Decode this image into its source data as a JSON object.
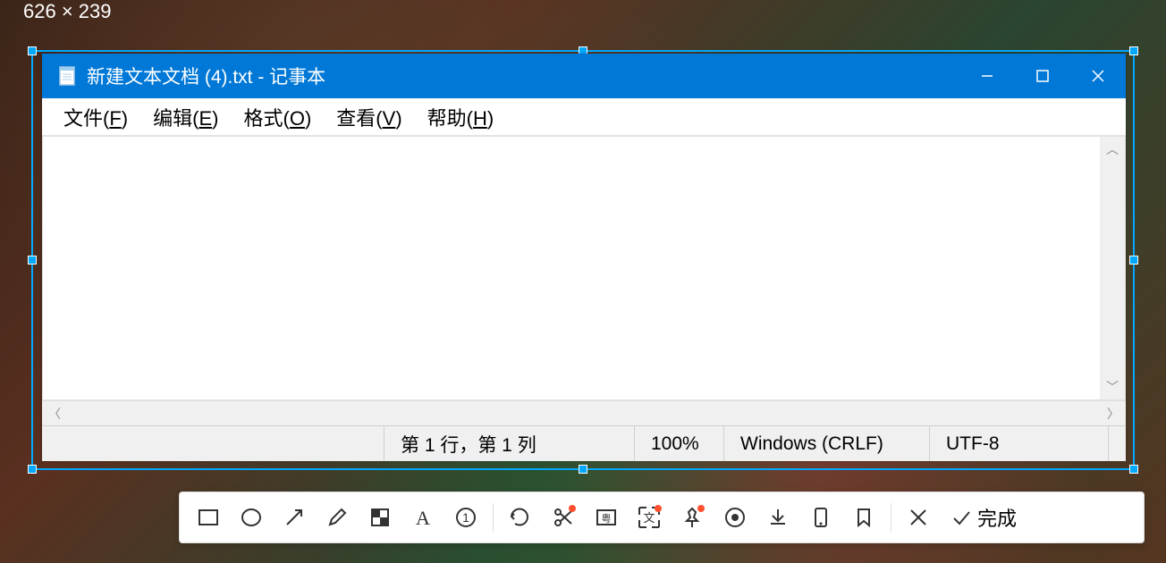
{
  "selection": {
    "size_label": "626 × 239"
  },
  "notepad": {
    "title": "新建文本文档 (4).txt - 记事本",
    "menus": {
      "file": {
        "label": "文件",
        "key": "F"
      },
      "edit": {
        "label": "编辑",
        "key": "E"
      },
      "format": {
        "label": "格式",
        "key": "O"
      },
      "view": {
        "label": "查看",
        "key": "V"
      },
      "help": {
        "label": "帮助",
        "key": "H"
      }
    },
    "content": "",
    "status": {
      "position": "第 1 行，第 1 列",
      "zoom": "100%",
      "line_ending": "Windows (CRLF)",
      "encoding": "UTF-8"
    }
  },
  "toolbar": {
    "done_label": "完成"
  }
}
